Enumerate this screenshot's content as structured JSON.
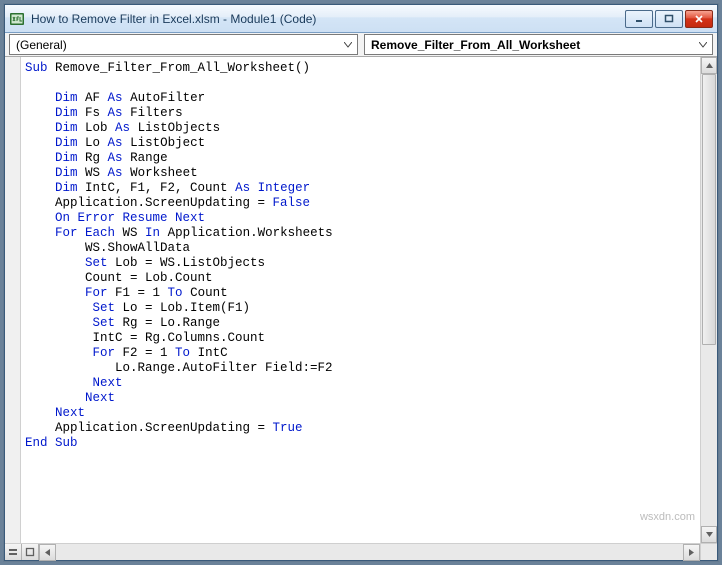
{
  "window": {
    "title": "How to Remove Filter in Excel.xlsm - Module1 (Code)"
  },
  "selectors": {
    "left": "(General)",
    "right": "Remove_Filter_From_All_Worksheet"
  },
  "code": {
    "tokens": [
      [
        "kw",
        "Sub"
      ],
      [
        "",
        " Remove_Filter_From_All_Worksheet()"
      ],
      [
        "br",
        ""
      ],
      [
        "br",
        ""
      ],
      [
        "",
        "    "
      ],
      [
        "kw",
        "Dim"
      ],
      [
        "",
        " AF "
      ],
      [
        "kw",
        "As"
      ],
      [
        "",
        " AutoFilter"
      ],
      [
        "br",
        ""
      ],
      [
        "",
        "    "
      ],
      [
        "kw",
        "Dim"
      ],
      [
        "",
        " Fs "
      ],
      [
        "kw",
        "As"
      ],
      [
        "",
        " Filters"
      ],
      [
        "br",
        ""
      ],
      [
        "",
        "    "
      ],
      [
        "kw",
        "Dim"
      ],
      [
        "",
        " Lob "
      ],
      [
        "kw",
        "As"
      ],
      [
        "",
        " ListObjects"
      ],
      [
        "br",
        ""
      ],
      [
        "",
        "    "
      ],
      [
        "kw",
        "Dim"
      ],
      [
        "",
        " Lo "
      ],
      [
        "kw",
        "As"
      ],
      [
        "",
        " ListObject"
      ],
      [
        "br",
        ""
      ],
      [
        "",
        "    "
      ],
      [
        "kw",
        "Dim"
      ],
      [
        "",
        " Rg "
      ],
      [
        "kw",
        "As"
      ],
      [
        "",
        " Range"
      ],
      [
        "br",
        ""
      ],
      [
        "",
        "    "
      ],
      [
        "kw",
        "Dim"
      ],
      [
        "",
        " WS "
      ],
      [
        "kw",
        "As"
      ],
      [
        "",
        " Worksheet"
      ],
      [
        "br",
        ""
      ],
      [
        "",
        "    "
      ],
      [
        "kw",
        "Dim"
      ],
      [
        "",
        " IntC, F1, F2, Count "
      ],
      [
        "kw",
        "As"
      ],
      [
        "",
        " "
      ],
      [
        "kw",
        "Integer"
      ],
      [
        "br",
        ""
      ],
      [
        "",
        "    Application.ScreenUpdating = "
      ],
      [
        "kw",
        "False"
      ],
      [
        "br",
        ""
      ],
      [
        "",
        "    "
      ],
      [
        "kw",
        "On Error Resume Next"
      ],
      [
        "br",
        ""
      ],
      [
        "",
        "    "
      ],
      [
        "kw",
        "For Each"
      ],
      [
        "",
        " WS "
      ],
      [
        "kw",
        "In"
      ],
      [
        "",
        " Application.Worksheets"
      ],
      [
        "br",
        ""
      ],
      [
        "",
        "        WS.ShowAllData"
      ],
      [
        "br",
        ""
      ],
      [
        "",
        "        "
      ],
      [
        "kw",
        "Set"
      ],
      [
        "",
        " Lob = WS.ListObjects"
      ],
      [
        "br",
        ""
      ],
      [
        "",
        "        Count = Lob.Count"
      ],
      [
        "br",
        ""
      ],
      [
        "",
        "        "
      ],
      [
        "kw",
        "For"
      ],
      [
        "",
        " F1 = 1 "
      ],
      [
        "kw",
        "To"
      ],
      [
        "",
        " Count"
      ],
      [
        "br",
        ""
      ],
      [
        "",
        "         "
      ],
      [
        "kw",
        "Set"
      ],
      [
        "",
        " Lo = Lob.Item(F1)"
      ],
      [
        "br",
        ""
      ],
      [
        "",
        "         "
      ],
      [
        "kw",
        "Set"
      ],
      [
        "",
        " Rg = Lo.Range"
      ],
      [
        "br",
        ""
      ],
      [
        "",
        "         IntC = Rg.Columns.Count"
      ],
      [
        "br",
        ""
      ],
      [
        "",
        "         "
      ],
      [
        "kw",
        "For"
      ],
      [
        "",
        " F2 = 1 "
      ],
      [
        "kw",
        "To"
      ],
      [
        "",
        " IntC"
      ],
      [
        "br",
        ""
      ],
      [
        "",
        "            Lo.Range.AutoFilter Field:=F2"
      ],
      [
        "br",
        ""
      ],
      [
        "",
        "         "
      ],
      [
        "kw",
        "Next"
      ],
      [
        "br",
        ""
      ],
      [
        "",
        "        "
      ],
      [
        "kw",
        "Next"
      ],
      [
        "br",
        ""
      ],
      [
        "",
        "    "
      ],
      [
        "kw",
        "Next"
      ],
      [
        "br",
        ""
      ],
      [
        "",
        "    Application.ScreenUpdating = "
      ],
      [
        "kw",
        "True"
      ],
      [
        "br",
        ""
      ],
      [
        "kw",
        "End Sub"
      ],
      [
        "br",
        ""
      ]
    ]
  },
  "watermark": "wsxdn.com"
}
